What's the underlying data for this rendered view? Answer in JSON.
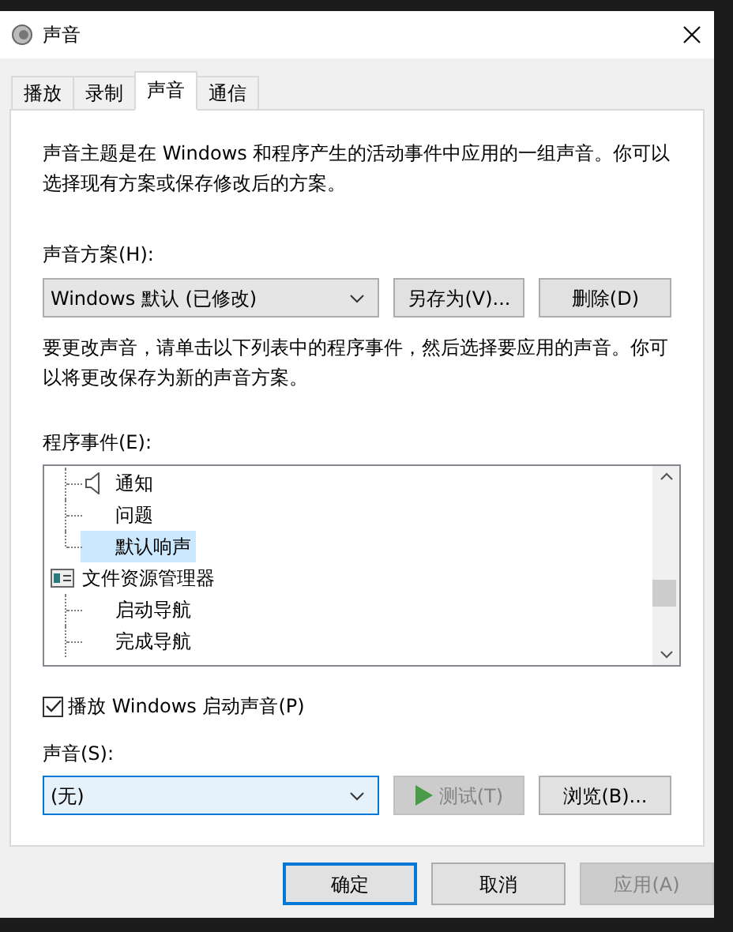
{
  "window": {
    "title": "声音"
  },
  "tabs": [
    {
      "label": "播放",
      "selected": false
    },
    {
      "label": "录制",
      "selected": false
    },
    {
      "label": "声音",
      "selected": true
    },
    {
      "label": "通信",
      "selected": false
    }
  ],
  "description": "声音主题是在 Windows 和程序产生的活动事件中应用的一组声音。你可以选择现有方案或保存修改后的方案。",
  "scheme": {
    "label": "声音方案(H):",
    "value": "Windows 默认 (已修改)",
    "buttons": [
      {
        "label": "另存为(V)...",
        "disabled": false
      },
      {
        "label": "删除(D)",
        "disabled": false
      }
    ]
  },
  "instructions": "要更改声音，请单击以下列表中的程序事件，然后选择要应用的声音。你可以将更改保存为新的声音方案。",
  "events": {
    "label": "程序事件(E):",
    "tree": [
      {
        "children": [
          {
            "label": "通知",
            "has_sound": true,
            "selected": false
          },
          {
            "label": "问题",
            "has_sound": false,
            "selected": false
          },
          {
            "label": "默认响声",
            "has_sound": false,
            "selected": true
          }
        ]
      },
      {
        "label": "文件资源管理器",
        "children": [
          {
            "label": "启动导航",
            "has_sound": false,
            "selected": false
          },
          {
            "label": "完成导航",
            "has_sound": false,
            "selected": false
          }
        ]
      }
    ]
  },
  "startup_sound": {
    "label": "播放 Windows 启动声音(P)",
    "checked": true
  },
  "sound": {
    "label": "声音(S):",
    "value": "(无)",
    "focused": true,
    "buttons": [
      {
        "kind": "test",
        "label": "测试(T)",
        "disabled": true
      },
      {
        "kind": "browse",
        "label": "浏览(B)...",
        "disabled": false
      }
    ]
  },
  "dialog_buttons": [
    {
      "label": "确定",
      "default": true,
      "disabled": false
    },
    {
      "label": "取消",
      "default": false,
      "disabled": false
    },
    {
      "label": "应用(A)",
      "default": false,
      "disabled": true
    }
  ]
}
